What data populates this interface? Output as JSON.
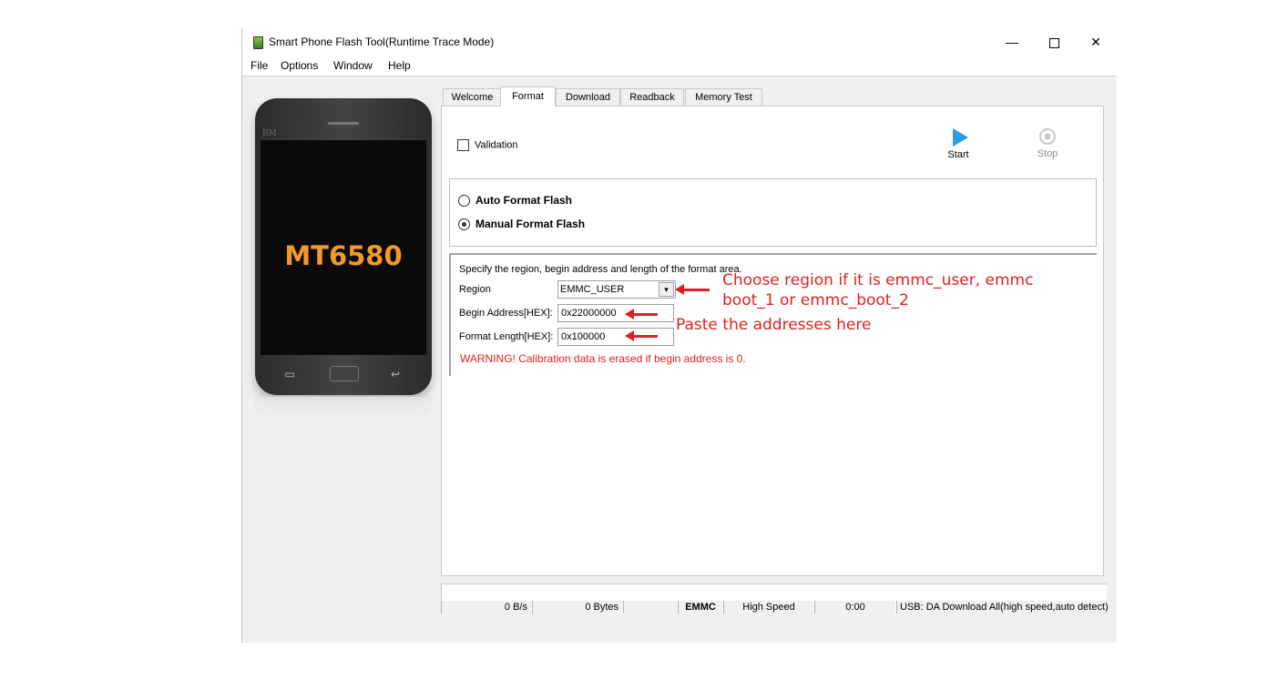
{
  "window": {
    "title": "Smart Phone Flash Tool(Runtime Trace Mode)",
    "controls": {
      "minimize": "—",
      "close": "✕"
    }
  },
  "menu": [
    "File",
    "Options",
    "Window",
    "Help"
  ],
  "phone": {
    "brand": "BM",
    "chip": "MT6580"
  },
  "tabs": [
    {
      "label": "Welcome",
      "active": false
    },
    {
      "label": "Format",
      "active": true
    },
    {
      "label": "Download",
      "active": false
    },
    {
      "label": "Readback",
      "active": false
    },
    {
      "label": "Memory Test",
      "active": false
    }
  ],
  "format": {
    "validation_label": "Validation",
    "validation_checked": false,
    "start_label": "Start",
    "stop_label": "Stop",
    "modes": [
      {
        "label": "Auto Format Flash",
        "selected": false
      },
      {
        "label": "Manual Format Flash",
        "selected": true
      }
    ],
    "spec_text": "Specify the region, begin address and length of the format area.",
    "region_label": "Region",
    "region_value": "EMMC_USER",
    "begin_label": "Begin Address[HEX]:",
    "begin_value": "0x22000000",
    "length_label": "Format Length[HEX]:",
    "length_value": "0x100000",
    "warning": "WARNING! Calibration data is erased if begin address is 0."
  },
  "annotations": {
    "region_note_line1": "Choose region if it is emmc_user, emmc",
    "region_note_line2": "boot_1 or emmc_boot_2",
    "address_note": "Paste the addresses here"
  },
  "status": {
    "speed": "0 B/s",
    "bytes": "0 Bytes",
    "blank": "",
    "storage": "EMMC",
    "mode": "High Speed",
    "time": "0:00",
    "usb": "USB: DA Download All(high speed,auto detect)"
  },
  "colors": {
    "accent_red": "#e02020",
    "start_blue": "#2d9be0",
    "chip_orange": "#f39a2a"
  },
  "icons": {
    "start": "play-icon",
    "stop": "stop-icon",
    "app": "phone-app-icon"
  }
}
